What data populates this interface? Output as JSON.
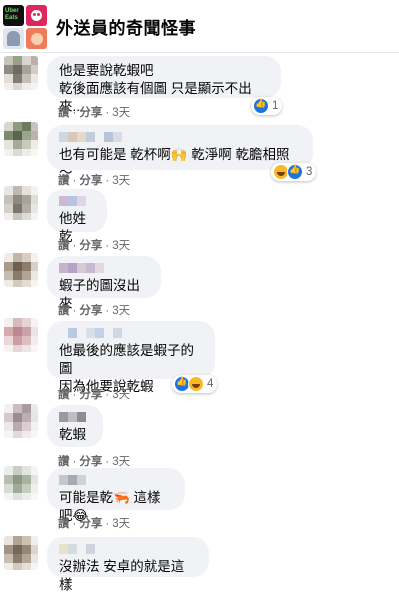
{
  "header": {
    "group_name": "外送員的奇聞怪事",
    "thumb_label": "Uber Eats"
  },
  "actions": {
    "like": "讚",
    "reply": "分享",
    "dot": "·"
  },
  "comments": [
    {
      "text": "他是要說乾蝦吧\n乾後面應該有個圖 只是顯示不出來...",
      "time": "3天",
      "reactions": [
        "like"
      ],
      "reaction_count": "1"
    },
    {
      "text": "也有可能是 乾杯啊🙌 乾淨啊 乾膽相照 ～",
      "time": "3天",
      "reactions": [
        "haha",
        "like"
      ],
      "reaction_count": "3"
    },
    {
      "text": "他姓乾",
      "time": "3天"
    },
    {
      "text": "蝦子的圖沒出來",
      "time": "3天"
    },
    {
      "text": "他最後的應該是蝦子的圖\n因為他要說乾蝦",
      "time": "3天",
      "reactions": [
        "like",
        "haha"
      ],
      "reaction_count": "4"
    },
    {
      "text": "乾蝦",
      "time": "3天"
    },
    {
      "text": "可能是乾🦐 這樣吧😂",
      "time": "3天"
    },
    {
      "text": "沒辦法 安卓的就是這樣",
      "time": ""
    }
  ]
}
